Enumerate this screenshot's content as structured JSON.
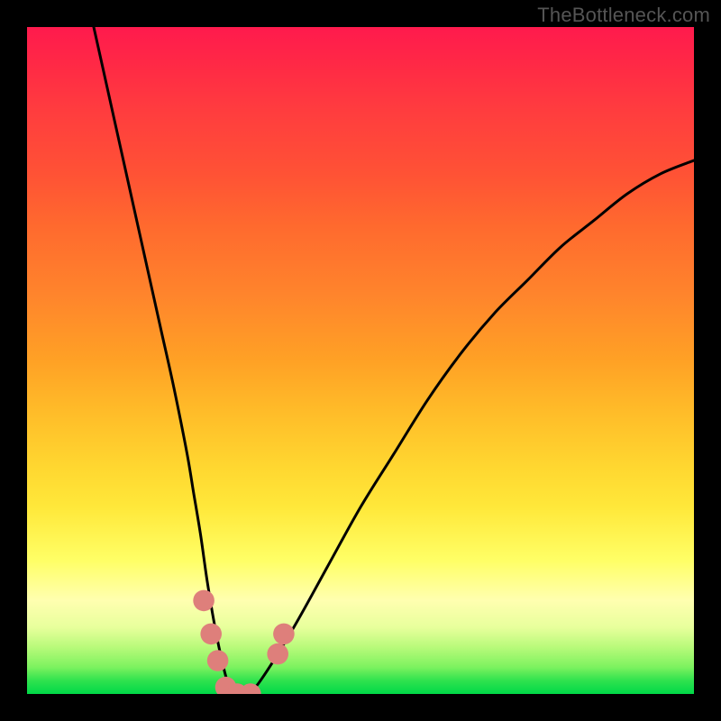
{
  "watermark": "TheBottleneck.com",
  "chart_data": {
    "type": "line",
    "title": "",
    "xlabel": "",
    "ylabel": "",
    "xlim": [
      0,
      100
    ],
    "ylim": [
      0,
      100
    ],
    "grid": false,
    "legend": false,
    "annotations": [],
    "background_gradient": {
      "orientation": "vertical",
      "stops": [
        {
          "pos": 0,
          "color": "#ff1a4d"
        },
        {
          "pos": 22,
          "color": "#ff5235"
        },
        {
          "pos": 50,
          "color": "#ffa125"
        },
        {
          "pos": 72,
          "color": "#ffe83a"
        },
        {
          "pos": 90,
          "color": "#e8ff9c"
        },
        {
          "pos": 100,
          "color": "#00d848"
        }
      ]
    },
    "series": [
      {
        "name": "bottleneck-curve",
        "color": "#000000",
        "x": [
          10,
          12,
          14,
          16,
          18,
          20,
          22,
          24,
          25,
          26,
          27,
          28,
          29,
          30,
          31,
          32,
          33,
          35,
          40,
          45,
          50,
          55,
          60,
          65,
          70,
          75,
          80,
          85,
          90,
          95,
          100
        ],
        "y": [
          100,
          91,
          82,
          73,
          64,
          55,
          46,
          36,
          30,
          24,
          17,
          11,
          6,
          2,
          0,
          0,
          0,
          2,
          10,
          19,
          28,
          36,
          44,
          51,
          57,
          62,
          67,
          71,
          75,
          78,
          80
        ]
      }
    ],
    "markers": [
      {
        "name": "bead-1",
        "x": 26.5,
        "y": 14,
        "color": "#de7f7b",
        "r": 1.6
      },
      {
        "name": "bead-2",
        "x": 27.6,
        "y": 9,
        "color": "#de7f7b",
        "r": 1.6
      },
      {
        "name": "bead-3",
        "x": 28.6,
        "y": 5,
        "color": "#de7f7b",
        "r": 1.6
      },
      {
        "name": "bead-4",
        "x": 29.8,
        "y": 1,
        "color": "#de7f7b",
        "r": 1.6
      },
      {
        "name": "bead-5",
        "x": 31.5,
        "y": 0,
        "color": "#de7f7b",
        "r": 1.6
      },
      {
        "name": "bead-6",
        "x": 33.5,
        "y": 0,
        "color": "#de7f7b",
        "r": 1.6
      },
      {
        "name": "bead-7",
        "x": 37.6,
        "y": 6,
        "color": "#de7f7b",
        "r": 1.6
      },
      {
        "name": "bead-8",
        "x": 38.5,
        "y": 9,
        "color": "#de7f7b",
        "r": 1.6
      }
    ]
  }
}
